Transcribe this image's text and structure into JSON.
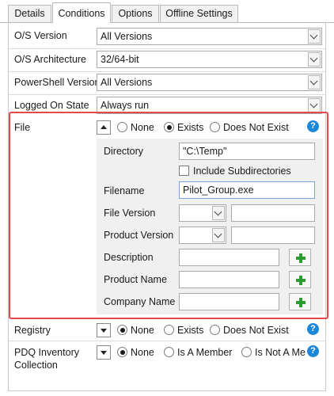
{
  "tabs": [
    {
      "label": "Details"
    },
    {
      "label": "Conditions"
    },
    {
      "label": "Options"
    },
    {
      "label": "Offline Settings"
    }
  ],
  "conditions": {
    "os_version": {
      "label": "O/S Version",
      "value": "All Versions"
    },
    "os_architecture": {
      "label": "O/S Architecture",
      "value": "32/64-bit"
    },
    "powershell_version": {
      "label": "PowerShell Version",
      "value": "All Versions"
    },
    "logged_on_state": {
      "label": "Logged On State",
      "value": "Always run"
    }
  },
  "file": {
    "label": "File",
    "options": [
      "None",
      "Exists",
      "Does Not Exist"
    ],
    "selected": "Exists",
    "directory": {
      "label": "Directory",
      "value": "\"C:\\Temp\""
    },
    "include_subdirectories": {
      "label": "Include Subdirectories",
      "checked": false
    },
    "filename": {
      "label": "Filename",
      "value": "Pilot_Group.exe"
    },
    "file_version": {
      "label": "File Version",
      "value": ""
    },
    "product_version": {
      "label": "Product Version",
      "value": ""
    },
    "description": {
      "label": "Description",
      "value": ""
    },
    "product_name": {
      "label": "Product Name",
      "value": ""
    },
    "company_name": {
      "label": "Company Name",
      "value": ""
    }
  },
  "registry": {
    "label": "Registry",
    "options": [
      "None",
      "Exists",
      "Does Not Exist"
    ],
    "selected": "None"
  },
  "pdq_inventory": {
    "label": "PDQ Inventory Collection",
    "label_line1": "PDQ Inventory",
    "label_line2": "Collection",
    "options": [
      "None",
      "Is A Member",
      "Is Not A Me"
    ],
    "selected": "None"
  },
  "icons": {
    "help": "help-icon",
    "add": "plus-icon",
    "dropdown": "chevron-down-icon"
  },
  "colors": {
    "highlight_border": "#e04b4b",
    "help_blue": "#1e88d8",
    "plus_green": "#2e9b2e"
  },
  "help_glyph": "?"
}
